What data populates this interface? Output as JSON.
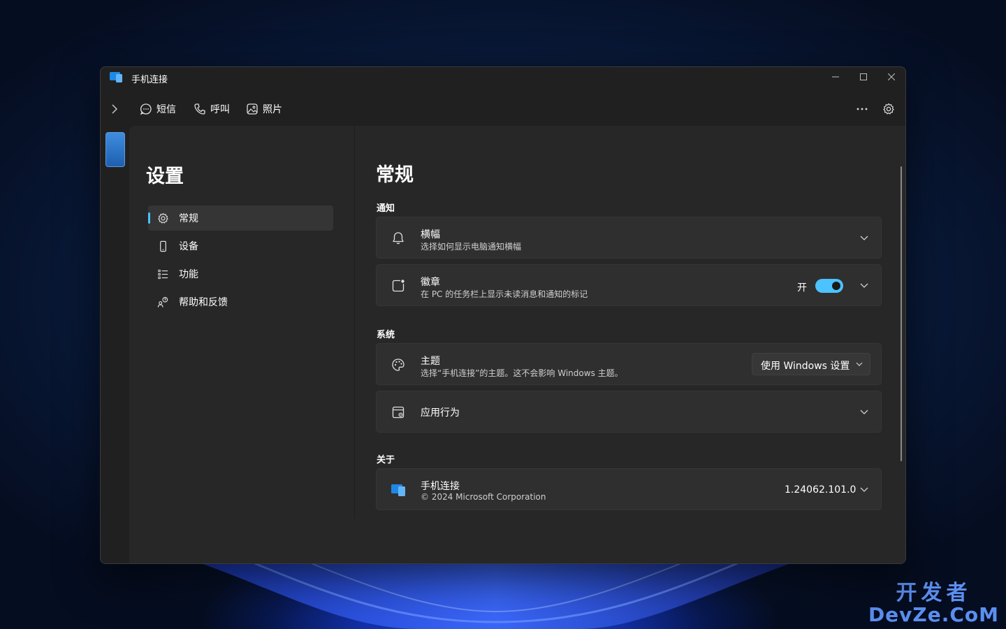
{
  "app": {
    "title": "手机连接"
  },
  "toolbar": {
    "tabs": [
      {
        "label": "短信",
        "icon": "message-icon"
      },
      {
        "label": "呼叫",
        "icon": "phone-icon"
      },
      {
        "label": "照片",
        "icon": "photo-icon"
      }
    ]
  },
  "sidebar": {
    "title": "设置",
    "items": [
      {
        "label": "常规",
        "icon": "gear-icon",
        "active": true
      },
      {
        "label": "设备",
        "icon": "device-icon"
      },
      {
        "label": "功能",
        "icon": "features-list-icon"
      },
      {
        "label": "帮助和反馈",
        "icon": "help-feedback-icon"
      }
    ]
  },
  "main": {
    "title": "常规",
    "sections": {
      "notifications": {
        "title": "通知",
        "banner": {
          "title": "横幅",
          "subtitle": "选择如何显示电脑通知横幅"
        },
        "badge": {
          "title": "徽章",
          "subtitle": "在 PC 的任务栏上显示未读消息和通知的标记",
          "toggle_label": "开",
          "toggle_on": true
        }
      },
      "system": {
        "title": "系统",
        "theme": {
          "title": "主题",
          "subtitle": "选择“手机连接”的主题。这不会影响 Windows 主题。",
          "selected": "使用 Windows 设置"
        },
        "behavior": {
          "title": "应用行为"
        }
      },
      "about": {
        "title": "关于",
        "app": {
          "title": "手机连接",
          "subtitle": "© 2024 Microsoft Corporation",
          "version": "1.24062.101.0"
        }
      }
    }
  },
  "watermark": {
    "cn": "开发者",
    "en": "DevZe.CoM"
  },
  "colors": {
    "accent": "#4cc2ff",
    "window_bg": "#202020",
    "content_bg": "#272727",
    "card_bg": "#2f2f2f"
  }
}
